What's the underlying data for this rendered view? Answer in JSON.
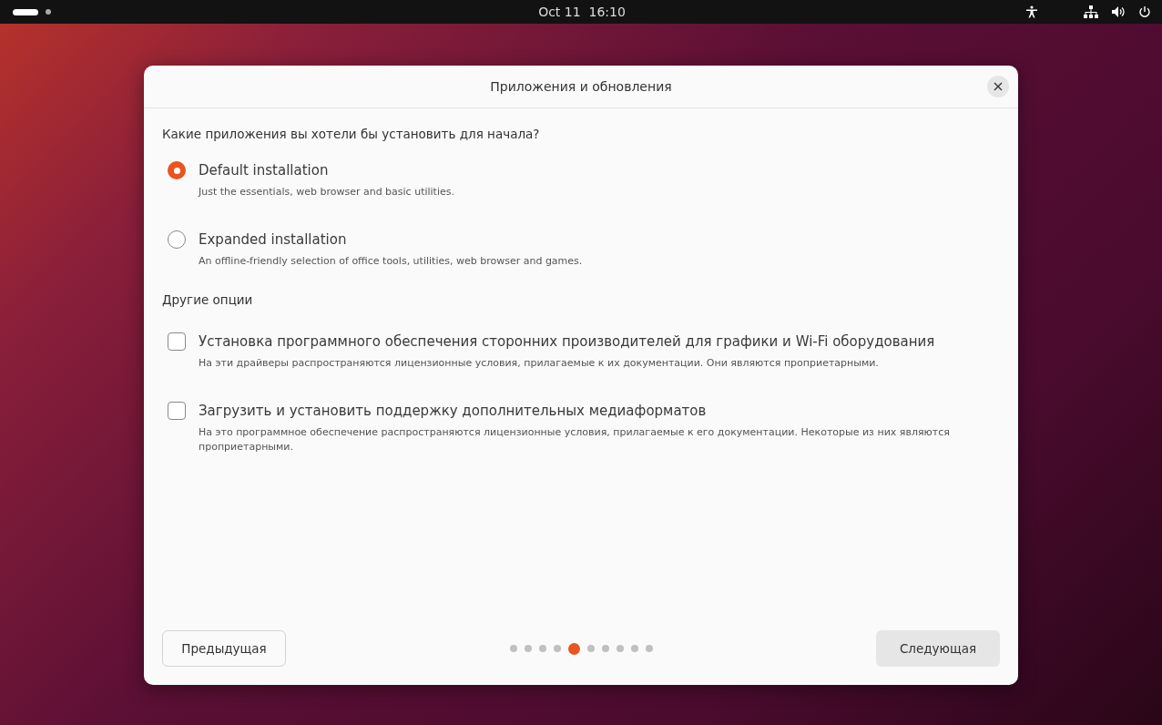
{
  "top_bar": {
    "workspaces": [
      {
        "selected": true
      },
      {
        "selected": false
      }
    ],
    "clock": "Oct 11  16:10"
  },
  "dialog": {
    "title": "Приложения и обновления",
    "question": "Какие приложения вы хотели бы установить для начала?",
    "install_options": [
      {
        "label": "Default installation",
        "description": "Just the essentials, web browser and basic utilities.",
        "selected": true
      },
      {
        "label": "Expanded installation",
        "description": "An offline-friendly selection of office tools, utilities, web browser and games.",
        "selected": false
      }
    ],
    "other_heading": "Другие опции",
    "other_options": [
      {
        "label": "Установка программного обеспечения сторонних производителей для графики и Wi-Fi оборудования",
        "description": "На эти драйверы распространяются лицензионные условия, прилагаемые к их документации. Они являются проприетарными.",
        "checked": false
      },
      {
        "label": "Загрузить и установить поддержку дополнительных медиаформатов",
        "description": "На это программное обеспечение распространяются лицензионные условия, прилагаемые к его документации. Некоторые из них являются проприетарными.",
        "checked": false
      }
    ],
    "back_button": "Предыдущая",
    "pages": [
      {
        "selected": false
      },
      {
        "selected": false
      },
      {
        "selected": false
      },
      {
        "selected": false
      },
      {
        "selected": true
      },
      {
        "selected": false
      },
      {
        "selected": false
      },
      {
        "selected": false
      },
      {
        "selected": false
      },
      {
        "selected": false
      }
    ],
    "next_button": "Следующая"
  }
}
